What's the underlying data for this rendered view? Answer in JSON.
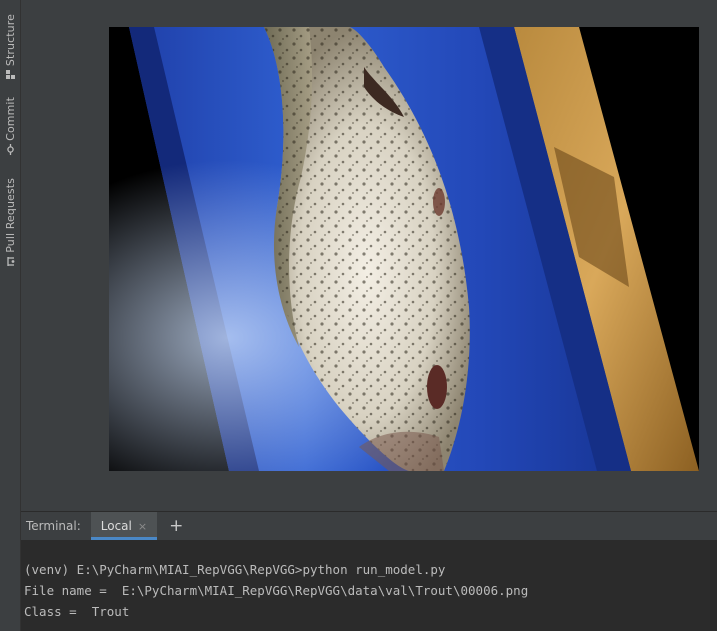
{
  "side_panel": {
    "tabs": [
      {
        "label": "Structure",
        "icon": "structure-icon"
      },
      {
        "label": "Commit",
        "icon": "commit-icon"
      },
      {
        "label": "Pull Requests",
        "icon": "pull-requests-icon"
      }
    ]
  },
  "image_viewer": {
    "subject": "trout on blue cutting board"
  },
  "terminal": {
    "title": "Terminal:",
    "tabs": [
      {
        "label": "Local",
        "active": true
      }
    ],
    "close_glyph": "×",
    "add_glyph": "+",
    "lines": [
      "(venv) E:\\PyCharm\\MIAI_RepVGG\\RepVGG>python run_model.py",
      "File name =  E:\\PyCharm\\MIAI_RepVGG\\RepVGG\\data\\val\\Trout\\00006.png",
      "Class =  Trout"
    ]
  },
  "colors": {
    "ide_background": "#3c3f41",
    "terminal_background": "#2b2b2b",
    "text": "#bbbbbb",
    "tab_underline": "#4a88c7"
  }
}
